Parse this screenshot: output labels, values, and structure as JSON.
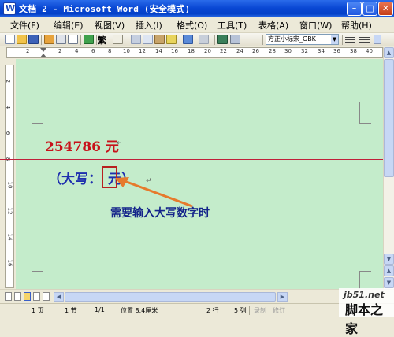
{
  "window": {
    "title": "文档 2 - Microsoft Word (安全模式)",
    "app_icon": "W"
  },
  "menu": [
    "文件(F)",
    "编辑(E)",
    "视图(V)",
    "插入(I)",
    "格式(O)",
    "工具(T)",
    "表格(A)",
    "窗口(W)",
    "帮助(H)"
  ],
  "toolbar": {
    "font_name": "方正小标宋_GBK",
    "traditional_label": "繁"
  },
  "ruler": {
    "ticks": [
      "2",
      "2",
      "4",
      "6",
      "8",
      "10",
      "12",
      "14",
      "16",
      "18",
      "20",
      "22",
      "24",
      "26",
      "28",
      "30",
      "32",
      "34",
      "36",
      "38",
      "40"
    ],
    "vticks": [
      "2",
      "4",
      "6",
      "8",
      "10",
      "12",
      "14",
      "16"
    ]
  },
  "document": {
    "amount_line": "254786 元",
    "capital_line": "（大写：",
    "capital_suffix": "元）",
    "paragraph_mark": "↵"
  },
  "annotation": {
    "callout": "需要输入大写数字时",
    "arrow_color": "#e67a2c"
  },
  "status": {
    "page": "1 页",
    "section": "1 节",
    "page_of": "1/1",
    "position": "位置 8.4厘米",
    "line": "2 行",
    "column": "5 列",
    "rec": "录制",
    "trk": "修订"
  },
  "watermark": {
    "site": "jb51.net",
    "name": "脚本之家"
  },
  "colors": {
    "doc_bg": "#c4eccb",
    "title_bar": "#0a48d4",
    "amount": "#c8121a",
    "capital": "#1e2fae"
  }
}
